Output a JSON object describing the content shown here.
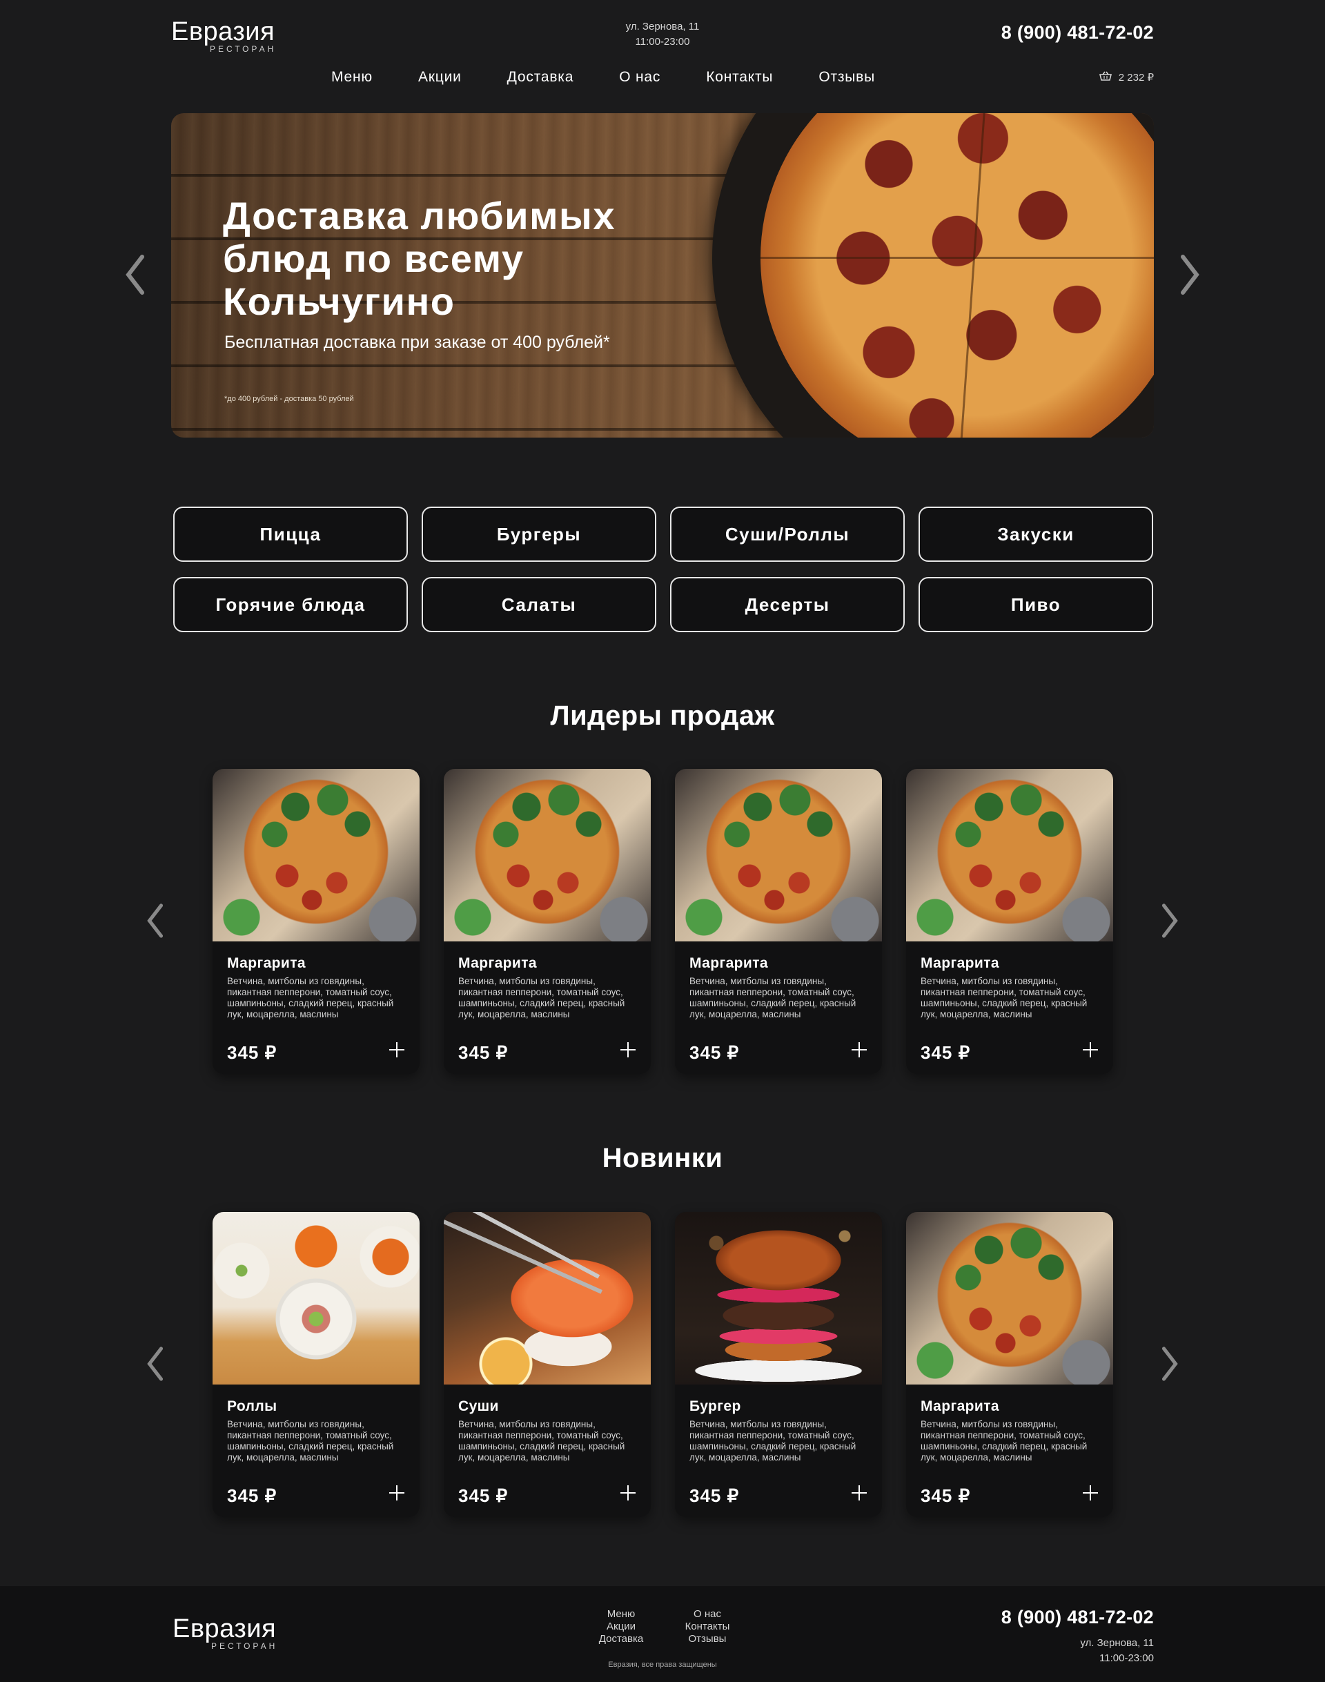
{
  "header": {
    "logo_name": "Евразия",
    "logo_sub": "РЕСТОРАН",
    "address": "ул. Зернова, 11",
    "hours": "11:00-23:00",
    "phone": "8 (900) 481-72-02",
    "nav": [
      "Меню",
      "Акции",
      "Доставка",
      "О нас",
      "Контакты",
      "Отзывы"
    ],
    "cart_total": "2 232 ₽",
    "cart_icon": "basket-icon"
  },
  "hero": {
    "title": "Доставка любимых блюд по всему Кольчугино",
    "subtitle": "Бесплатная доставка при заказе от 400 рублей*",
    "note": "*до 400 рублей - доставка 50 рублей",
    "prev_icon": "chevron-left-icon",
    "next_icon": "chevron-right-icon"
  },
  "categories": [
    "Пицца",
    "Бургеры",
    "Суши/Роллы",
    "Закуски",
    "Горячие блюда",
    "Салаты",
    "Десерты",
    "Пиво"
  ],
  "bestsellers": {
    "title": "Лидеры продаж",
    "items": [
      {
        "name": "Маргарита",
        "desc": "Ветчина, митболы из говядины, пикантная пепперони, томатный соус, шампиньоны, сладкий перец, красный лук, моцарелла, маслины",
        "price": "345 ₽",
        "image": "pizza"
      },
      {
        "name": "Маргарита",
        "desc": "Ветчина, митболы из говядины, пикантная пепперони, томатный соус, шампиньоны, сладкий перец, красный лук, моцарелла, маслины",
        "price": "345 ₽",
        "image": "pizza"
      },
      {
        "name": "Маргарита",
        "desc": "Ветчина, митболы из говядины, пикантная пепперони, томатный соус, шампиньоны, сладкий перец, красный лук, моцарелла, маслины",
        "price": "345 ₽",
        "image": "pizza"
      },
      {
        "name": "Маргарита",
        "desc": "Ветчина, митболы из говядины, пикантная пепперони, томатный соус, шампиньоны, сладкий перец, красный лук, моцарелла, маслины",
        "price": "345 ₽",
        "image": "pizza"
      }
    ]
  },
  "novelties": {
    "title": "Новинки",
    "items": [
      {
        "name": "Роллы",
        "desc": "Ветчина, митболы из говядины, пикантная пепперони, томатный соус, шампиньоны, сладкий перец, красный лук, моцарелла, маслины",
        "price": "345 ₽",
        "image": "rolls"
      },
      {
        "name": "Суши",
        "desc": "Ветчина, митболы из говядины, пикантная пепперони, томатный соус, шампиньоны, сладкий перец, красный лук, моцарелла, маслины",
        "price": "345 ₽",
        "image": "sushi"
      },
      {
        "name": "Бургер",
        "desc": "Ветчина, митболы из говядины, пикантная пепперони, томатный соус, шампиньоны, сладкий перец, красный лук, моцарелла, маслины",
        "price": "345 ₽",
        "image": "burger"
      },
      {
        "name": "Маргарита",
        "desc": "Ветчина, митболы из говядины, пикантная пепперони, томатный соус, шампиньоны, сладкий перец, красный лук, моцарелла, маслины",
        "price": "345 ₽",
        "image": "pizza"
      }
    ]
  },
  "footer": {
    "logo_name": "Евразия",
    "logo_sub": "РЕСТОРАН",
    "links": [
      "Меню",
      "О нас",
      "Акции",
      "Контакты",
      "Доставка",
      "Отзывы"
    ],
    "copyright": "Евразия, все права защищены",
    "phone": "8 (900) 481-72-02",
    "address": "ул. Зернова, 11",
    "hours": "11:00-23:00"
  },
  "colors": {
    "background": "#1b1b1c",
    "card": "#111112",
    "text": "#ffffff",
    "border": "#e8e8e8"
  }
}
